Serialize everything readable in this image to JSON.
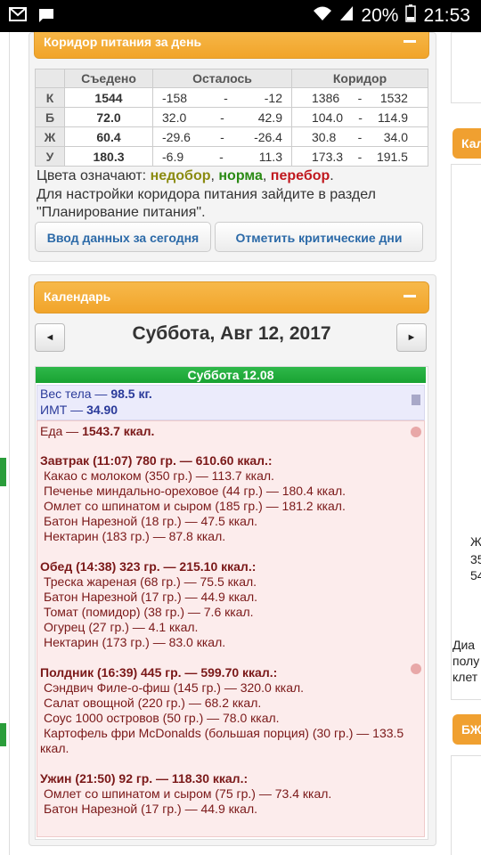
{
  "status_bar": {
    "battery_pct": "20%",
    "time": "21:53",
    "icons": [
      "mail-icon",
      "chat-icon",
      "wifi-icon",
      "signal-icon",
      "battery-icon"
    ]
  },
  "nutrition_corridor": {
    "title": "Коридор питания за день",
    "headers": {
      "eaten": "Съедено",
      "remaining": "Осталось",
      "corridor": "Коридор"
    },
    "rows": [
      {
        "label": "К",
        "eaten": "1544",
        "eaten_color": "red",
        "remaining_min": "-158",
        "remaining_max": "-12",
        "corridor_min": "1386",
        "corridor_max": "1532"
      },
      {
        "label": "Б",
        "eaten": "72.0",
        "eaten_color": "olive",
        "remaining_min": "32.0",
        "remaining_max": "42.9",
        "corridor_min": "104.0",
        "corridor_max": "114.9"
      },
      {
        "label": "Ж",
        "eaten": "60.4",
        "eaten_color": "red",
        "remaining_min": "-29.6",
        "remaining_max": "-26.4",
        "corridor_min": "30.8",
        "corridor_max": "34.0"
      },
      {
        "label": "У",
        "eaten": "180.3",
        "eaten_color": "green",
        "remaining_min": "-6.9",
        "remaining_max": "11.3",
        "corridor_min": "173.3",
        "corridor_max": "191.5"
      }
    ],
    "dash": "-",
    "legend_prefix": "Цвета означают: ",
    "legend_under": "недобор",
    "legend_sep1": ", ",
    "legend_norm": "норма",
    "legend_sep2": ", ",
    "legend_over": "перебор",
    "legend_end": ".",
    "note": "Для настройки коридора питания зайдите в раздел \"Планирование питания\".",
    "btn_enter": "Ввод данных за сегодня",
    "btn_critical": "Отметить критические дни",
    "colors": {
      "under": "#8b8b10",
      "norm": "#2a8a14",
      "over": "#c0181e"
    }
  },
  "calendar": {
    "title": "Календарь",
    "prev": "◄",
    "next": "►",
    "date_title": "Суббота, Авг 12, 2017",
    "day_header": "Суббота 12.08",
    "weight_text": "Вес тела — ",
    "weight_val": "98.5 кг.",
    "bmi_text": "ИМТ — ",
    "bmi_val": "34.90",
    "food_text": "Еда — ",
    "food_val": "1543.7 ккал.",
    "meals": [
      {
        "title": "Завтрак (11:07) 780 гр. — 610.60 ккал.:",
        "items": [
          "Какао с молоком (350 гр.) — 113.7 ккал.",
          "Печенье миндально-ореховое (44 гр.) — 180.4 ккал.",
          "Омлет со шпинатом и сыром (185 гр.) — 181.2 ккал.",
          "Батон Нарезной (18 гр.) — 47.5 ккал.",
          "Нектарин (183 гр.) — 87.8 ккал."
        ]
      },
      {
        "title": "Обед (14:38) 323 гр. — 215.10 ккал.:",
        "items": [
          "Треска жареная (68 гр.) — 75.5 ккал.",
          "Батон Нарезной (17 гр.) — 44.9 ккал.",
          "Томат (помидор) (38 гр.) — 7.6 ккал.",
          "Огурец (27 гр.) — 4.1 ккал.",
          "Нектарин (173 гр.) — 83.0 ккал."
        ]
      },
      {
        "title": "Полдник (16:39) 445 гр. — 599.70 ккал.:",
        "items": [
          "Сэндвич Филе-о-фиш (145 гр.) — 320.0 ккал.",
          "Салат овощной (220 гр.) — 68.2 ккал.",
          "Соус 1000 островов (50 гр.) — 78.0 ккал.",
          "Картофель фри McDonalds (большая порция) (30 гр.) — 133.5",
          "ккал."
        ]
      },
      {
        "title": "Ужин (21:50) 92 гр. — 118.30 ккал.:",
        "items": [
          "Омлет со шпинатом и сыром (75 гр.) — 73.4 ккал.",
          "Батон Нарезной (17 гр.) — 44.9 ккал."
        ]
      }
    ]
  },
  "right_column": {
    "tab1": "Кал",
    "tab2": "БЖ",
    "snippet1": [
      "Ж",
      "35",
      "54"
    ],
    "snippet2": [
      "Диа",
      "полу",
      "клет"
    ]
  }
}
